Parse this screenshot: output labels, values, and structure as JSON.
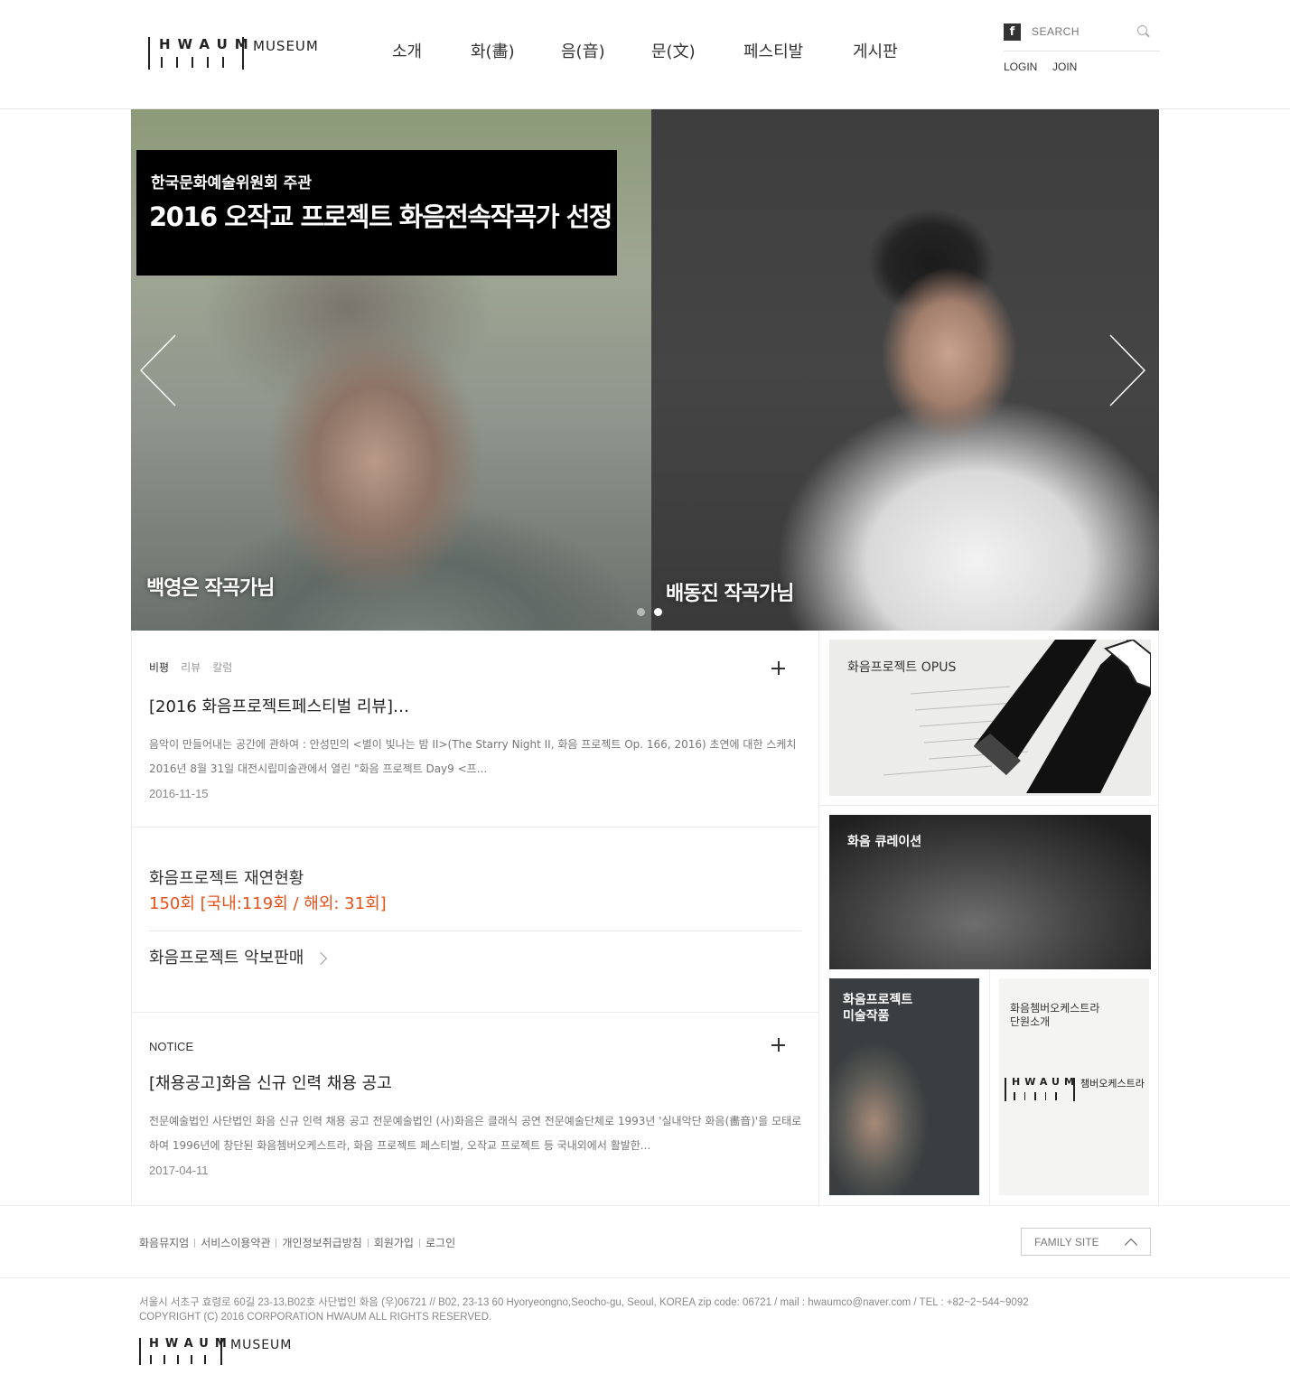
{
  "header": {
    "logo_letters": "HWAUM",
    "logo_word": "MUSEUM",
    "nav": [
      "소개",
      "화(畵)",
      "음(音)",
      "문(文)",
      "페스티발",
      "게시판"
    ],
    "facebook_icon": "facebook-icon",
    "search_placeholder": "SEARCH",
    "login": "LOGIN",
    "join": "JOIN"
  },
  "hero": {
    "banner_sub": "한국문화예술위원회 주관",
    "banner_title": "2016 오작교 프로젝트 화음전속작곡가 선정",
    "left_name": "백영은 작곡가님",
    "right_name": "배동진 작곡가님",
    "slide_count": 2,
    "active_slide": 2
  },
  "review": {
    "tabs": [
      "비평",
      "리뷰",
      "칼럼"
    ],
    "title": "[2016 화음프로젝트페스티벌 리뷰]…",
    "body": "음악이 만들어내는 공간에 관하여 : 안성민의 <별이 빛나는 밤 II>(The Starry Night II, 화음 프로젝트 Op. 166, 2016) 초연에 대한 스케치 2016년 8월 31일 대전시립미술관에서 열린 \"화음 프로젝트 Day9 <프...",
    "date": "2016-11-15"
  },
  "stats": {
    "title": "화음프로젝트 재연현황",
    "value": "150회 [국내:119회 / 해외: 31회]",
    "score_link": "화음프로젝트 악보판매"
  },
  "notice": {
    "label": "NOTICE",
    "title": "[채용공고]화음 신규 인력 채용 공고",
    "body": "전문예술법인 사단법인 화음 신규 인력 채용 공고 전문예술법인 (사)화음은 클래식 공연 전문예술단체로 1993년 '실내악단 화음(畵音)'을 모태로 하여 1996년에 창단된 화음쳄버오케스트라, 화음 프로젝트 페스티벌, 오작교 프로젝트 등 국내외에서 활발한...",
    "date": "2017-04-11"
  },
  "tiles": {
    "opus": "화음프로젝트 OPUS",
    "curation": "화음 큐레이션",
    "art_line1": "화음프로젝트",
    "art_line2": "미술작품",
    "orch_line1": "화음쳄버오케스트라",
    "orch_line2": "단원소개",
    "orch_logo_letters": "HWAUM",
    "orch_logo_word": "챔버오케스트라"
  },
  "footer": {
    "links": [
      "화음뮤지엄",
      "서비스이용약관",
      "개인정보취급방침",
      "회원가입",
      "로그인"
    ],
    "family_site": "FAMILY SITE",
    "address": "서울시 서초구 효령로 60길 23-13,B02호 사단법인 화음 (우)06721 // B02, 23-13 60 Hyoryeongno,Seocho-gu, Seoul, KOREA zip code: 06721 / mail : hwaumco@naver.com / TEL : +82~2~544~9092",
    "copyright": "COPYRIGHT (C) 2016 CORPORATION HWAUM ALL RIGHTS RESERVED.",
    "logo_letters": "HWAUM",
    "logo_word": "MUSEUM"
  }
}
